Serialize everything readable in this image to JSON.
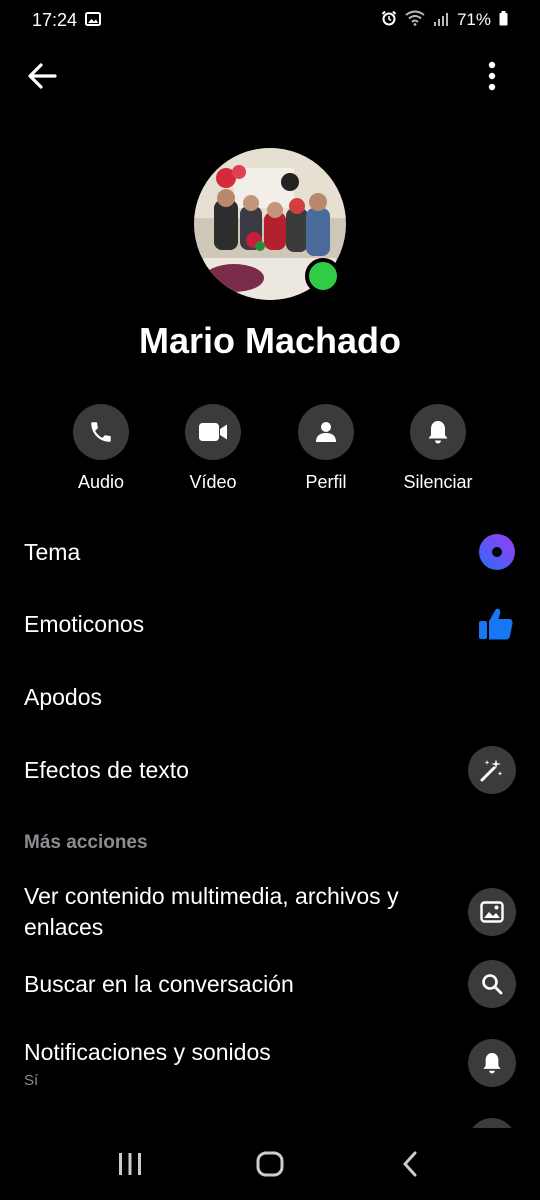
{
  "status_bar": {
    "time": "17:24",
    "battery": "71%"
  },
  "profile": {
    "name": "Mario Machado"
  },
  "actions": [
    {
      "label": "Audio",
      "icon": "phone-icon"
    },
    {
      "label": "Vídeo",
      "icon": "video-icon"
    },
    {
      "label": "Perfil",
      "icon": "person-icon"
    },
    {
      "label": "Silenciar",
      "icon": "bell-icon"
    }
  ],
  "settings": {
    "tema": "Tema",
    "emoticonos": "Emoticonos",
    "apodos": "Apodos",
    "efectos": "Efectos de texto"
  },
  "more_actions": {
    "header": "Más acciones",
    "media": "Ver contenido multimedia, archivos y enlaces",
    "search": "Buscar en la conversación",
    "notifications": "Notificaciones y sonidos",
    "notifications_sub": "Sí"
  },
  "colors": {
    "background": "#000000",
    "circle": "#3a3b3c",
    "online": "#31cc46",
    "accent_blue": "#1877f2",
    "theme_gradient_start": "#2a6cf5",
    "theme_gradient_end": "#9b3cf5"
  }
}
